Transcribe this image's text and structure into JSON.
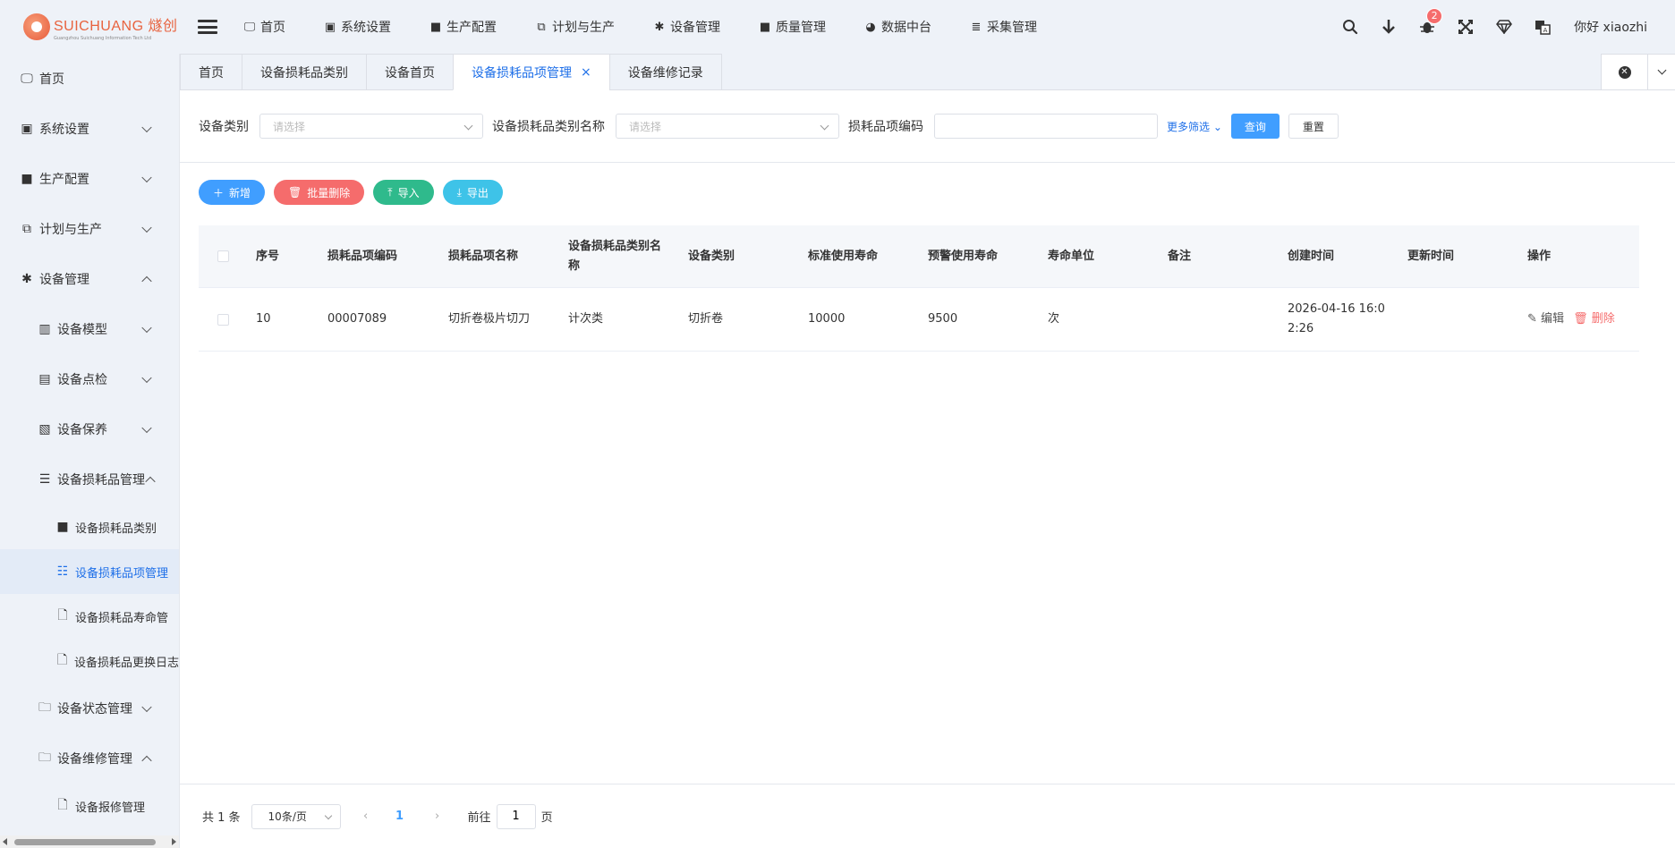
{
  "logo": {
    "main": "SUICHUANG 燧创",
    "sub": "Guangzhou Suichuang Information Tech Ltd"
  },
  "topnav": [
    {
      "label": "首页",
      "icon": "monitor-icon"
    },
    {
      "label": "系统设置",
      "icon": "user-badge-icon"
    },
    {
      "label": "生产配置",
      "icon": "briefcase-icon"
    },
    {
      "label": "计划与生产",
      "icon": "windows-icon"
    },
    {
      "label": "设备管理",
      "icon": "gear-icon"
    },
    {
      "label": "质量管理",
      "icon": "briefcase-icon"
    },
    {
      "label": "数据中台",
      "icon": "pie-chart-icon"
    },
    {
      "label": "采集管理",
      "icon": "database-icon"
    }
  ],
  "header": {
    "badge_count": "2",
    "greeting": "你好 xiaozhi"
  },
  "sidebar": {
    "items": [
      {
        "label": "首页"
      },
      {
        "label": "系统设置"
      },
      {
        "label": "生产配置"
      },
      {
        "label": "计划与生产"
      },
      {
        "label": "设备管理"
      },
      {
        "label": "设备模型"
      },
      {
        "label": "设备点检"
      },
      {
        "label": "设备保养"
      },
      {
        "label": "设备损耗品管理"
      },
      {
        "label": "设备损耗品类别"
      },
      {
        "label": "设备损耗品项管理"
      },
      {
        "label": "设备损耗品寿命管"
      },
      {
        "label": "设备损耗品更换日志"
      },
      {
        "label": "设备状态管理"
      },
      {
        "label": "设备维修管理"
      },
      {
        "label": "设备报修管理"
      }
    ]
  },
  "tabs": [
    {
      "label": "首页"
    },
    {
      "label": "设备损耗品类别"
    },
    {
      "label": "设备首页"
    },
    {
      "label": "设备损耗品项管理"
    },
    {
      "label": "设备维修记录"
    }
  ],
  "filter": {
    "label1": "设备类别",
    "placeholder1": "请选择",
    "label2": "设备损耗品类别名称",
    "placeholder2": "请选择",
    "label3": "损耗品项编码",
    "value3": "",
    "more": "更多筛选",
    "query": "查询",
    "reset": "重置"
  },
  "actions": {
    "add": "新增",
    "batch_delete": "批量删除",
    "import": "导入",
    "export": "导出"
  },
  "table": {
    "columns": [
      "序号",
      "损耗品项编码",
      "损耗品项名称",
      "设备损耗品类别名称",
      "设备类别",
      "标准使用寿命",
      "预警使用寿命",
      "寿命单位",
      "备注",
      "创建时间",
      "更新时间",
      "操作"
    ],
    "rows": [
      {
        "index": "10",
        "code": "00007089",
        "name": "切折卷极片切刀",
        "category": "计次类",
        "device_type": "切折卷",
        "std_life": "10000",
        "warn_life": "9500",
        "unit": "次",
        "remark": "",
        "created": "2026-04-16 16:02:26",
        "updated": ""
      }
    ],
    "edit_label": "编辑",
    "delete_label": "删除"
  },
  "pagination": {
    "total": "共 1 条",
    "page_size": "10条/页",
    "current": "1",
    "goto_label": "前往",
    "goto_value": "1",
    "page_suffix": "页"
  }
}
